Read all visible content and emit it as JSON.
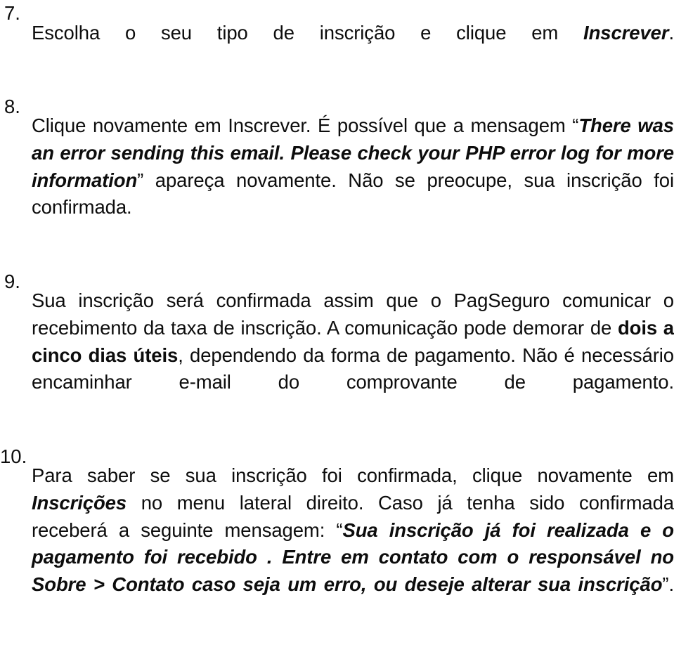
{
  "document": {
    "language": "pt-BR",
    "text_color": "#0d0d0d",
    "background_color": "#ffffff",
    "alignment": "justified",
    "items": [
      {
        "number": "7.",
        "runs": [
          {
            "text": "Escolha o seu tipo de inscrição e clique em ",
            "style": "regular"
          },
          {
            "text": "Inscrever",
            "style": "bold-italic"
          },
          {
            "text": ".",
            "style": "regular"
          }
        ]
      },
      {
        "number": "8.",
        "runs": [
          {
            "text": "Clique novamente em Inscrever. É possível que a mensagem ",
            "style": "regular"
          },
          {
            "text": "“",
            "style": "regular"
          },
          {
            "text": "There was an error sending this email. Please check your PHP error log for more information",
            "style": "bold-italic"
          },
          {
            "text": "”",
            "style": "regular"
          },
          {
            "text": " apareça novamente. Não se preocupe, sua inscrição foi confirmada.",
            "style": "regular"
          }
        ]
      },
      {
        "number": "9.",
        "runs": [
          {
            "text": "Sua inscrição será confirmada assim que o PagSeguro comunicar o recebimento da taxa de inscrição. A comunicação pode demorar de ",
            "style": "regular"
          },
          {
            "text": "dois a cinco dias úteis",
            "style": "bold"
          },
          {
            "text": ", dependendo da forma de pagamento. Não é necessário encaminhar e-mail do comprovante de pagamento.",
            "style": "regular"
          }
        ]
      },
      {
        "number": "10.",
        "runs": [
          {
            "text": "Para saber se sua inscrição foi confirmada, clique novamente em ",
            "style": "regular"
          },
          {
            "text": "Inscrições",
            "style": "bold-italic"
          },
          {
            "text": " no menu lateral direito. Caso já tenha sido confirmada receberá a seguinte mensagem: ",
            "style": "regular"
          },
          {
            "text": "“",
            "style": "regular"
          },
          {
            "text": "Sua inscrição já foi realizada e o pagamento foi recebido . Entre em contato com o responsável no Sobre > Contato caso seja um erro, ou deseje alterar sua inscrição",
            "style": "bold-italic"
          },
          {
            "text": "”",
            "style": "regular"
          },
          {
            "text": ".",
            "style": "regular"
          }
        ]
      }
    ]
  }
}
